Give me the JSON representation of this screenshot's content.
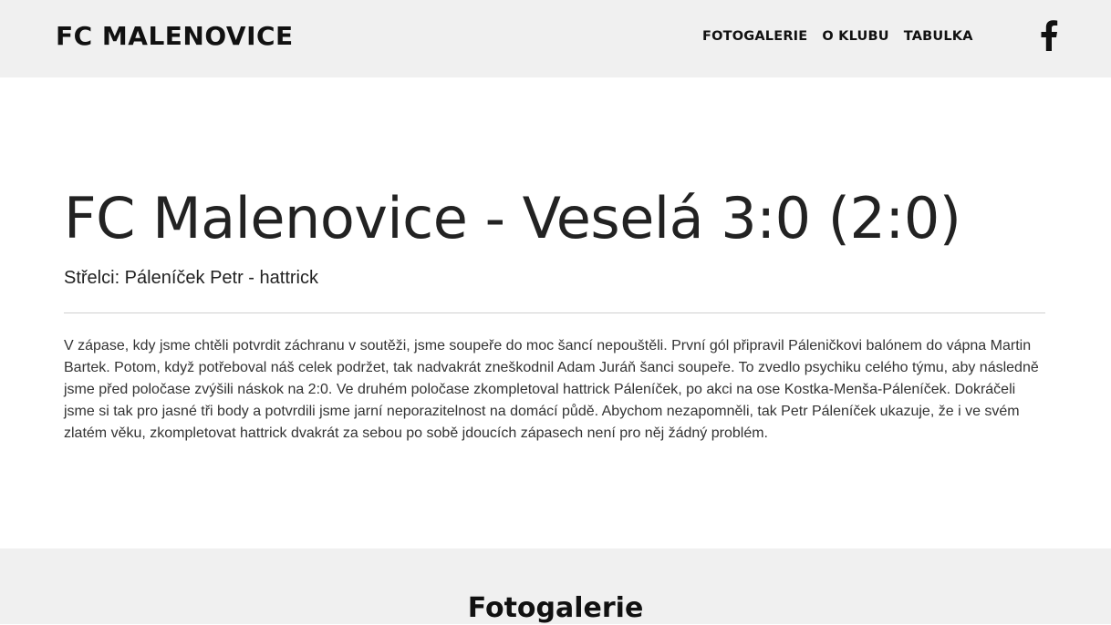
{
  "header": {
    "logo": "FC MALENOVICE",
    "nav": [
      "FOTOGALERIE",
      "O KLUBU",
      "TABULKA"
    ],
    "social_icon": "facebook-icon"
  },
  "match": {
    "title": "FC Malenovice - Veselá 3:0 (2:0)",
    "scorers": "Střelci: Páleníček Petr - hattrick",
    "report": "V zápase, kdy jsme chtěli potvrdit záchranu v soutěži, jsme soupeře do moc šancí nepouštěli. První gól připravil Páleničkovi balónem do vápna Martin Bartek. Potom, když potřeboval náš celek podržet, tak nadvakrát zneškodnil Adam Juráň šanci soupeře. To zvedlo psychiku celého týmu, aby následně jsme před poločase zvýšili náskok na 2:0. Ve druhém poločase zkompletoval hattrick Páleníček, po akci na ose Kostka-Menša-Páleníček. Dokráčeli jsme si tak pro jasné tři body a potvrdili jsme jarní neporazitelnost na domácí půdě. Abychom nezapomněli, tak Petr Páleníček ukazuje, že i ve svém zlatém věku, zkompletovat hattrick dvakrát za sebou po sobě jdoucích zápasech není pro něj žádný problém."
  },
  "gallery": {
    "title": "Fotogalerie"
  },
  "colors": {
    "header_bg": "#f0f0f0",
    "text": "#212529",
    "divider": "#cfcfcf"
  }
}
